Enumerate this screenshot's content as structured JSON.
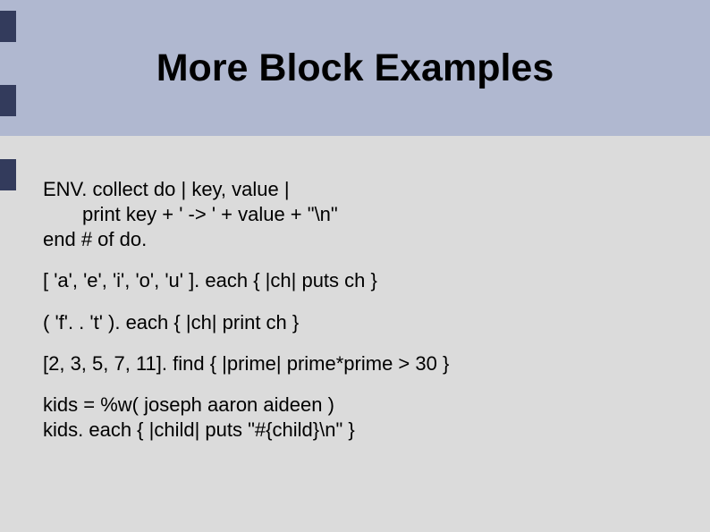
{
  "title": "More Block Examples",
  "code": {
    "block1_line1": "ENV. collect do | key, value |",
    "block1_line2": "print key + ' -> ' + value + \"\\n\"",
    "block1_line3": "end # of do.",
    "block2": "[ 'a', 'e', 'i', 'o', 'u' ]. each { |ch| puts ch }",
    "block3": "( 'f'. . 't' ). each { |ch| print ch }",
    "block4": "[2, 3, 5, 7, 11]. find { |prime| prime*prime > 30 }",
    "block5_line1": "kids = %w( joseph aaron aideen )",
    "block5_line2": "kids. each { |child| puts \"#{child}\\n\" }"
  }
}
